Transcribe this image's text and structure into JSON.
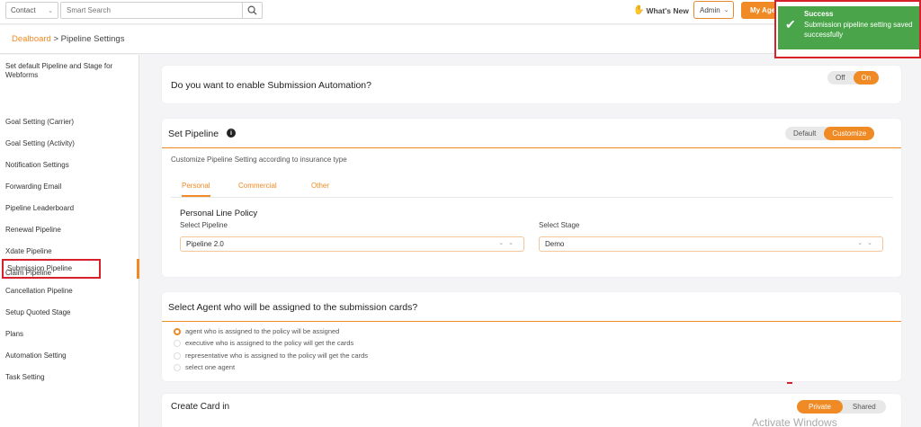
{
  "topbar": {
    "contact_select": "Contact",
    "search_placeholder": "Smart Search",
    "whats_new": "What's New",
    "admin_select": "Admin",
    "my_agency": "My Age"
  },
  "breadcrumb": {
    "link": "Dealboard",
    "separator": " > ",
    "current": "Pipeline Settings"
  },
  "sidebar": {
    "items": [
      "Set default Pipeline and Stage for Webforms",
      "Goal Setting (Carrier)",
      "Goal Setting (Activity)",
      "Notification Settings",
      "Forwarding Email",
      "Pipeline Leaderboard",
      "Renewal Pipeline",
      "Xdate Pipeline",
      "Claim Pipeline",
      "Submission Pipeline",
      "Cancellation Pipeline",
      "Setup Quoted Stage",
      "Plans",
      "Automation Setting",
      "Task Setting"
    ],
    "active_index": 9
  },
  "automation": {
    "question": "Do you want to enable Submission Automation?",
    "off": "Off",
    "on": "On"
  },
  "set_pipeline": {
    "title": "Set Pipeline",
    "default": "Default",
    "customize": "Customize",
    "description": "Customize Pipeline Setting according to insurance type",
    "tabs": [
      "Personal",
      "Commercial",
      "Other"
    ],
    "section_title": "Personal Line Policy",
    "select_pipeline_label": "Select Pipeline",
    "select_pipeline_value": "Pipeline 2.0",
    "select_stage_label": "Select Stage",
    "select_stage_value": "Demo"
  },
  "agent": {
    "title": "Select Agent who will be assigned to the submission cards?",
    "options": [
      "agent who is assigned to the policy will be assigned",
      "executive who is assigned to the policy will get the cards",
      "representative who is assigned to the policy will get the cards",
      "select one agent"
    ],
    "selected_index": 0
  },
  "create_card": {
    "title": "Create Card in",
    "private": "Private",
    "shared": "Shared"
  },
  "toast": {
    "title": "Success",
    "message": "Submission pipeline setting saved successfully"
  },
  "watermark": "Activate Windows",
  "colors": {
    "accent": "#f08a24",
    "success": "#4aa54a",
    "highlight_red": "#d6212a"
  }
}
